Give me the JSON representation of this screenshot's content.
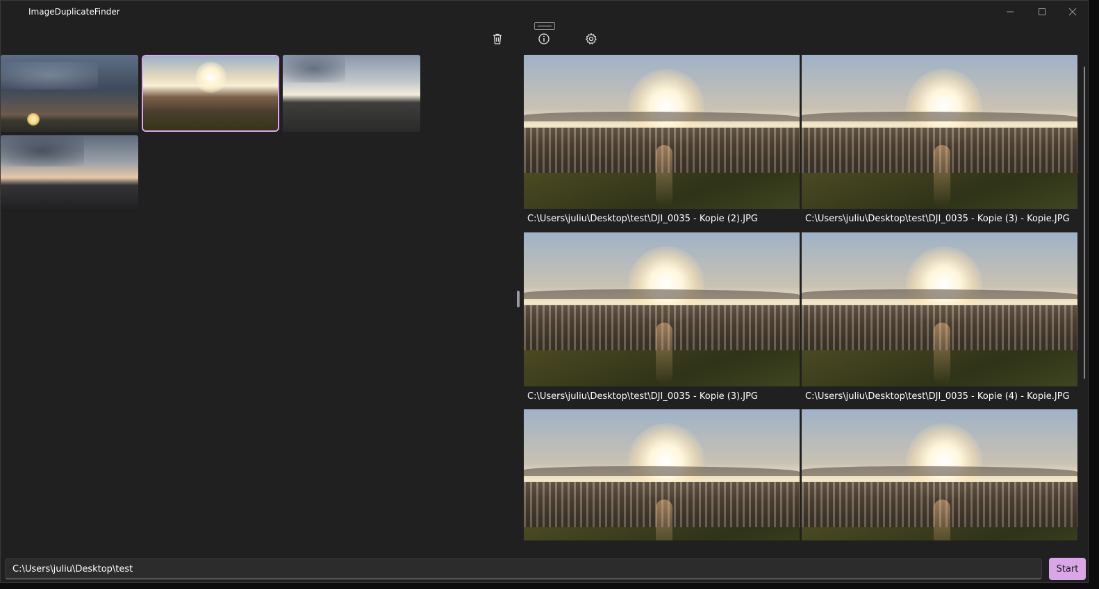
{
  "window": {
    "title": "ImageDuplicateFinder"
  },
  "toolbar": {
    "delete_icon": "trash-icon",
    "info_icon": "info-icon",
    "settings_icon": "gear-icon"
  },
  "thumbnails": [
    {
      "name": "thumbnail-1",
      "selected": false,
      "scene": "sunset-clouds"
    },
    {
      "name": "thumbnail-2",
      "selected": true,
      "scene": "sunset-village"
    },
    {
      "name": "thumbnail-3",
      "selected": false,
      "scene": "dusk-horizon"
    },
    {
      "name": "thumbnail-4",
      "selected": false,
      "scene": "dusk-horizon-dark"
    }
  ],
  "duplicates": [
    {
      "caption": "C:\\Users\\juliu\\Desktop\\test\\DJI_0035 - Kopie (2).JPG"
    },
    {
      "caption": "C:\\Users\\juliu\\Desktop\\test\\DJI_0035 - Kopie (3) - Kopie.JPG"
    },
    {
      "caption": "C:\\Users\\juliu\\Desktop\\test\\DJI_0035 - Kopie (3).JPG"
    },
    {
      "caption": "C:\\Users\\juliu\\Desktop\\test\\DJI_0035 - Kopie (4) - Kopie.JPG"
    },
    {
      "caption": ""
    },
    {
      "caption": ""
    }
  ],
  "footer": {
    "path_value": "C:\\Users\\juliu\\Desktop\\test",
    "start_label": "Start"
  },
  "colors": {
    "accent": "#d9a7e8",
    "background": "#202020"
  }
}
